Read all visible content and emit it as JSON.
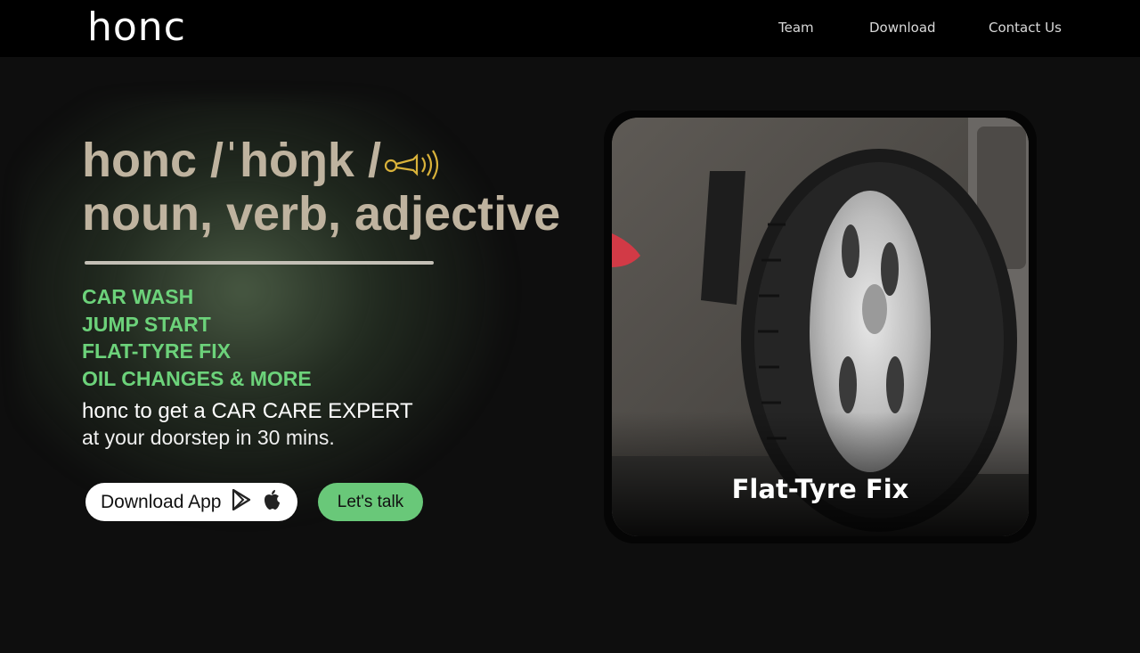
{
  "nav": {
    "logo": "honc",
    "links": [
      "Team",
      "Download",
      "Contact Us"
    ]
  },
  "hero": {
    "heading_line1": "honc /ˈhȯŋk /",
    "heading_line2": "noun, verb, adjective",
    "services": [
      "CAR WASH",
      "JUMP START",
      "FLAT-TYRE FIX",
      "OIL CHANGES & MORE"
    ],
    "tagline1": "honc to get a CAR CARE EXPERT",
    "tagline2": "at your doorstep in 30 mins."
  },
  "buttons": {
    "download": "Download App",
    "talk": "Let's talk"
  },
  "card": {
    "caption": "Flat-Tyre Fix"
  },
  "colors": {
    "accent_green": "#69c879",
    "heading_beige": "#bfb39f",
    "horn_gold": "#d9b23a",
    "background": "#0e0e0e"
  },
  "icons": [
    "horn-icon",
    "google-play-icon",
    "apple-icon"
  ]
}
